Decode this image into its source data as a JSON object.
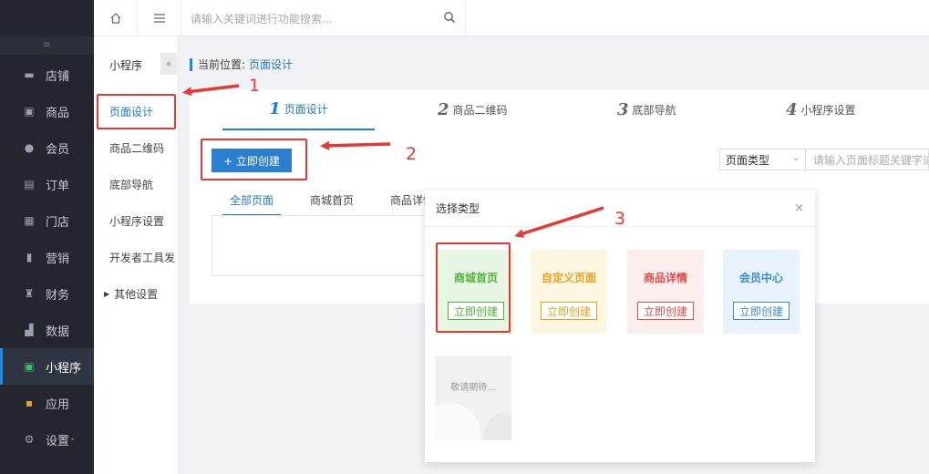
{
  "topbar": {
    "search_placeholder": "请输入关键词进行功能搜索..."
  },
  "sidebar": {
    "collapse_glyph": "≡",
    "items": [
      {
        "label": "店铺",
        "icon": "shop-icon"
      },
      {
        "label": "商品",
        "icon": "goods-icon"
      },
      {
        "label": "会员",
        "icon": "user-icon"
      },
      {
        "label": "订单",
        "icon": "order-icon"
      },
      {
        "label": "门店",
        "icon": "store-icon"
      },
      {
        "label": "营销",
        "icon": "marketing-icon"
      },
      {
        "label": "财务",
        "icon": "finance-icon"
      },
      {
        "label": "数据",
        "icon": "data-icon"
      },
      {
        "label": "小程序",
        "icon": "miniprogram-icon",
        "active": true
      },
      {
        "label": "应用",
        "icon": "apps-icon"
      },
      {
        "label": "设置",
        "icon": "gear-icon"
      }
    ]
  },
  "subsidebar": {
    "title": "小程序",
    "toggle_glyph": "«",
    "items": [
      {
        "label": "页面设计",
        "active": true
      },
      {
        "label": "商品二维码"
      },
      {
        "label": "底部导航"
      },
      {
        "label": "小程序设置"
      },
      {
        "label": "开发者工具发"
      },
      {
        "label": "其他设置"
      }
    ]
  },
  "breadcrumb": {
    "prefix": "当前位置:",
    "current": "页面设计"
  },
  "steps": [
    {
      "num": "1",
      "label": "页面设计",
      "active": true
    },
    {
      "num": "2",
      "label": "商品二维码"
    },
    {
      "num": "3",
      "label": "底部导航"
    },
    {
      "num": "4",
      "label": "小程序设置"
    }
  ],
  "toolbar": {
    "create_label": "+ 立即创建",
    "type_select_value": "页面类型",
    "keyword_placeholder": "请输入页面标题关键字进"
  },
  "filter_tabs": [
    {
      "label": "全部页面",
      "active": true
    },
    {
      "label": "商城首页"
    },
    {
      "label": "商品详情"
    }
  ],
  "modal": {
    "title": "选择类型",
    "close_glyph": "×",
    "cards": [
      {
        "title": "商城首页",
        "button": "立即创建",
        "color": "#52b43c",
        "bg": "#e8f6e4"
      },
      {
        "title": "自定义页面",
        "button": "立即创建",
        "color": "#e8a21f",
        "bg": "#fdf6e0"
      },
      {
        "title": "商品详情",
        "button": "立即创建",
        "color": "#e04b4b",
        "bg": "#fdeeee"
      },
      {
        "title": "会员中心",
        "button": "立即创建",
        "color": "#3a8fd8",
        "bg": "#e9f3fd"
      }
    ],
    "waiting_label": "敬请期待..."
  },
  "annotations": {
    "n1": "1",
    "n2": "2",
    "n3": "3",
    "color": "#e53935"
  },
  "colors": {
    "accent": "#1e7bd6",
    "sidebar_bg": "#23262e"
  }
}
